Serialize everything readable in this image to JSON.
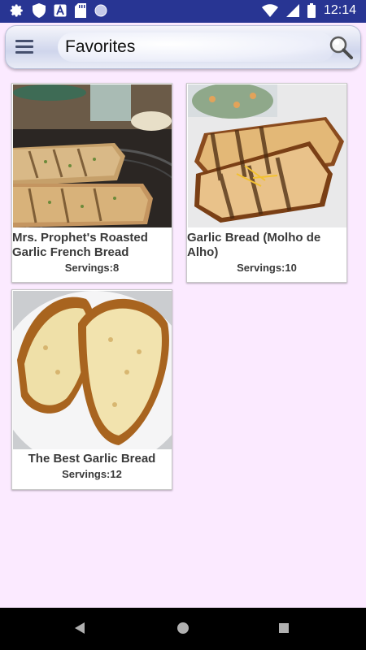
{
  "status_bar": {
    "time": "12:14",
    "left_icons": [
      "gear-icon",
      "shield-icon",
      "a-box-icon",
      "sd-card-icon",
      "circle-icon"
    ],
    "right_icons": [
      "wifi-icon",
      "signal-icon",
      "battery-icon"
    ]
  },
  "app_bar": {
    "title": "Favorites",
    "menu_icon": "hamburger-menu-icon",
    "search_icon": "search-icon"
  },
  "favorites": [
    {
      "title": "Mrs. Prophet's Roasted Garlic French Bread",
      "servings": "Servings:8"
    },
    {
      "title": "Garlic Bread (Molho de Alho)",
      "servings": "Servings:10"
    },
    {
      "title": "The Best Garlic Bread",
      "servings": "Servings:12"
    }
  ],
  "nav_bar": {
    "icons": [
      "back-icon",
      "home-icon",
      "recents-icon"
    ]
  },
  "colors": {
    "status_bar": "#283593",
    "background": "#fbeaff",
    "card_text": "#3a3a3a"
  }
}
